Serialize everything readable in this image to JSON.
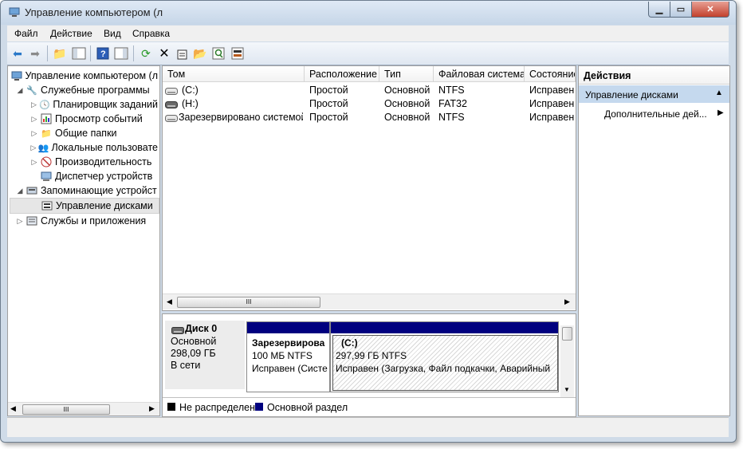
{
  "window": {
    "title": "Управление компьютером (л"
  },
  "menu": [
    "Файл",
    "Действие",
    "Вид",
    "Справка"
  ],
  "toolbar_icons": [
    "back-icon",
    "forward-icon",
    "up-folder-icon",
    "show-hide-tree-icon",
    "help-icon",
    "properties-pane-icon",
    "refresh-icon",
    "delete-icon",
    "properties-icon",
    "open-icon",
    "search-icon",
    "disk-settings-icon"
  ],
  "tree": {
    "root": "Управление компьютером (л",
    "items": [
      {
        "label": "Служебные программы",
        "level": 1,
        "expanded": true
      },
      {
        "label": "Планировщик заданий",
        "level": 2
      },
      {
        "label": "Просмотр событий",
        "level": 2
      },
      {
        "label": "Общие папки",
        "level": 2
      },
      {
        "label": "Локальные пользовате",
        "level": 2
      },
      {
        "label": "Производительность",
        "level": 2
      },
      {
        "label": "Диспетчер устройств",
        "level": 2
      },
      {
        "label": "Запоминающие устройст",
        "level": 1,
        "expanded": true
      },
      {
        "label": "Управление дисками",
        "level": 2,
        "selected": true
      },
      {
        "label": "Службы и приложения",
        "level": 1
      }
    ]
  },
  "volumes": {
    "columns": [
      "Том",
      "Расположение",
      "Тип",
      "Файловая система",
      "Состояние"
    ],
    "rows": [
      [
        "(C:)",
        "Простой",
        "Основной",
        "NTFS",
        "Исправен"
      ],
      [
        "(H:)",
        "Простой",
        "Основной",
        "FAT32",
        "Исправен"
      ],
      [
        "Зарезервировано системой",
        "Простой",
        "Основной",
        "NTFS",
        "Исправен"
      ]
    ]
  },
  "disk": {
    "name": "Диск 0",
    "type": "Основной",
    "size": "298,09 ГБ",
    "status": "В сети",
    "partitions": [
      {
        "name": "Зарезервирова",
        "size": "100 МБ NTFS",
        "status": "Исправен (Систе"
      },
      {
        "name": "(C:)",
        "size": "297,99 ГБ NTFS",
        "status": "Исправен (Загрузка, Файл подкачки, Аварийный"
      }
    ]
  },
  "legend": [
    {
      "label": "Не распределен",
      "color": "#000000"
    },
    {
      "label": "Основной раздел",
      "color": "#00007f"
    }
  ],
  "actions": {
    "header": "Действия",
    "section": "Управление дисками",
    "more": "Дополнительные дей..."
  },
  "colors": {
    "partition_bar": "#00007f",
    "selected_action": "#c5d9ee"
  }
}
